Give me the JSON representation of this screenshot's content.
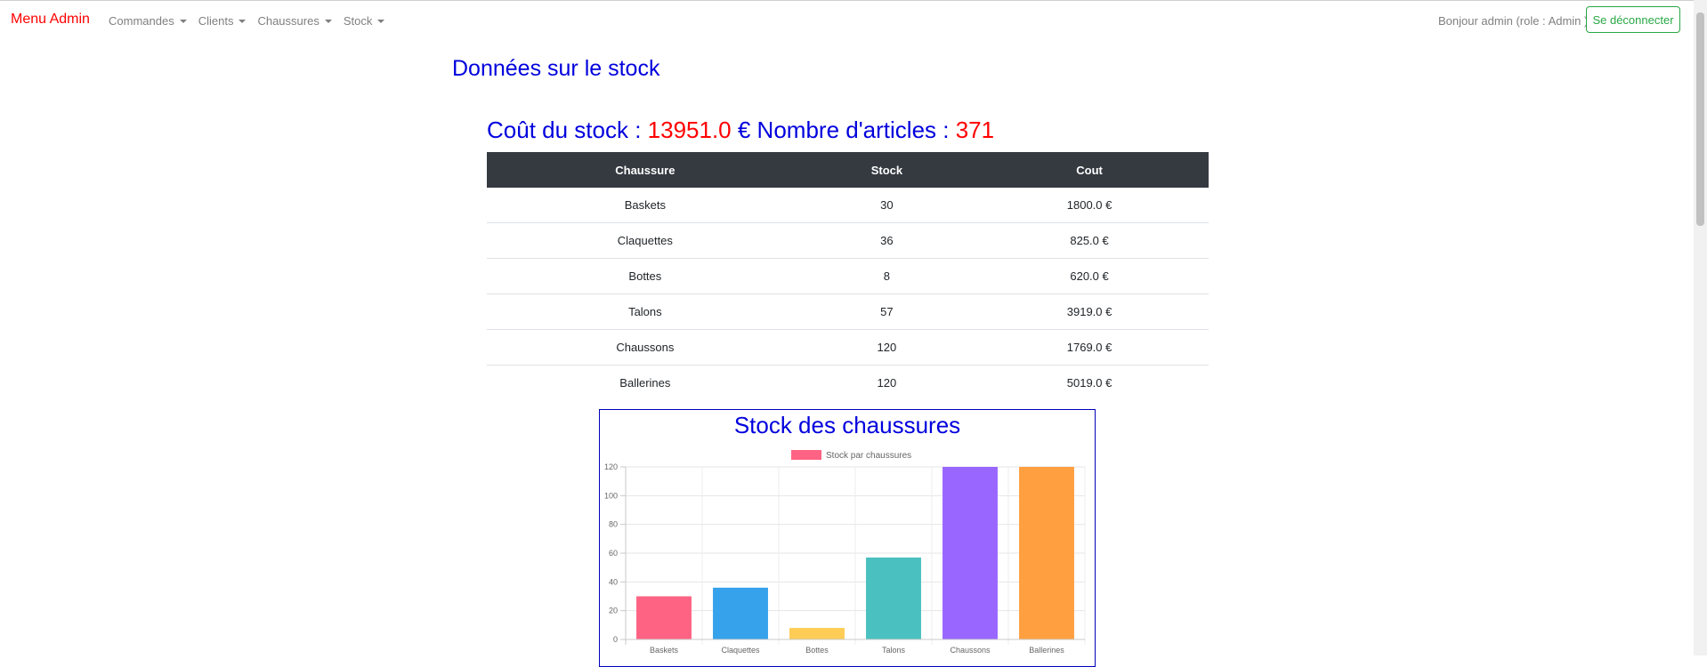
{
  "navbar": {
    "brand": "Menu Admin",
    "menu": [
      "Commandes",
      "Clients",
      "Chaussures",
      "Stock"
    ],
    "greeting": "Bonjour admin (role : Admin )",
    "logout": "Se déconnecter"
  },
  "page": {
    "title": "Données sur le stock",
    "cost_label": "Coût du stock : ",
    "cost_value": "13951.0",
    "currency": " €",
    "count_label": " Nombre d'articles : ",
    "count_value": "371"
  },
  "table": {
    "headers": [
      "Chaussure",
      "Stock",
      "Cout"
    ],
    "rows": [
      [
        "Baskets",
        "30",
        "1800.0 €"
      ],
      [
        "Claquettes",
        "36",
        "825.0 €"
      ],
      [
        "Bottes",
        "8",
        "620.0 €"
      ],
      [
        "Talons",
        "57",
        "3919.0 €"
      ],
      [
        "Chaussons",
        "120",
        "1769.0 €"
      ],
      [
        "Ballerines",
        "120",
        "5019.0 €"
      ]
    ]
  },
  "chart_data": {
    "type": "bar",
    "title": "Stock des chaussures",
    "categories": [
      "Baskets",
      "Claquettes",
      "Bottes",
      "Talons",
      "Chaussons",
      "Ballerines"
    ],
    "series": [
      {
        "name": "Stock par chaussures",
        "values": [
          30,
          36,
          8,
          57,
          120,
          120
        ]
      }
    ],
    "colors": [
      "#ff6384",
      "#36a2eb",
      "#ffcd56",
      "#4bc0c0",
      "#9966ff",
      "#ff9f40"
    ],
    "legend_color": "#ff6384",
    "ylim": [
      0,
      120
    ],
    "yticks": [
      0,
      20,
      40,
      60,
      80,
      100,
      120
    ],
    "grid": true,
    "legend": "top"
  }
}
